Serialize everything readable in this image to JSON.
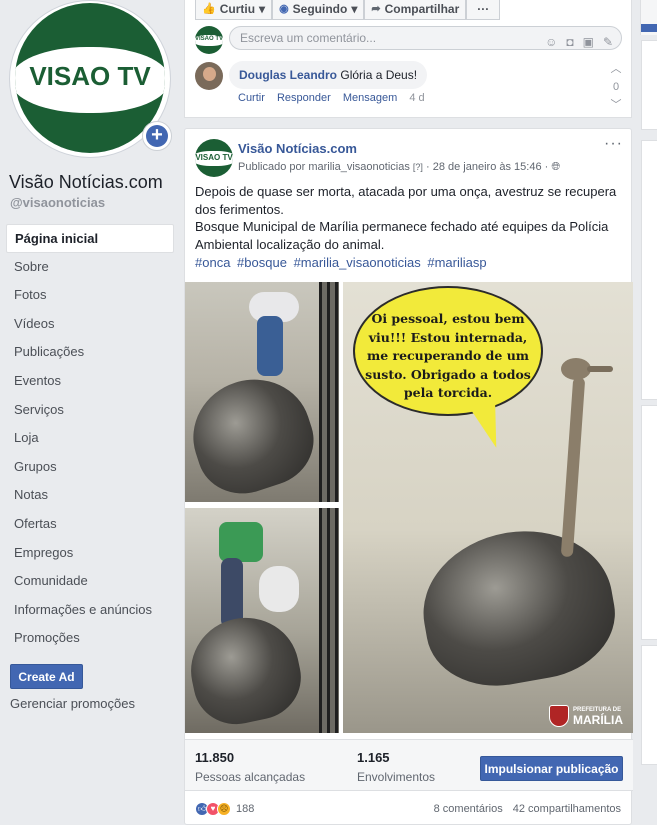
{
  "page": {
    "logo_text": "VISAO TV",
    "name": "Visão Notícias.com",
    "handle": "@visaonoticias"
  },
  "nav": [
    {
      "label": "Página inicial",
      "active": true
    },
    {
      "label": "Sobre"
    },
    {
      "label": "Fotos"
    },
    {
      "label": "Vídeos"
    },
    {
      "label": "Publicações"
    },
    {
      "label": "Eventos"
    },
    {
      "label": "Serviços"
    },
    {
      "label": "Loja"
    },
    {
      "label": "Grupos"
    },
    {
      "label": "Notas"
    },
    {
      "label": "Ofertas"
    },
    {
      "label": "Empregos"
    },
    {
      "label": "Comunidade"
    },
    {
      "label": "Informações e anúncios"
    },
    {
      "label": "Promoções"
    }
  ],
  "sidebar": {
    "create_ad": "Create Ad",
    "manage_promotions": "Gerenciar promoções"
  },
  "top_card": {
    "liked": "Curtiu",
    "following": "Seguindo",
    "share": "Compartilhar",
    "more": "···",
    "comment_placeholder": "Escreva um comentário...",
    "reply": {
      "author": "Douglas Leandro",
      "text": "Glória a Deus!",
      "like": "Curtir",
      "respond": "Responder",
      "message": "Mensagem",
      "time": "4 d",
      "votes": "0"
    }
  },
  "post": {
    "author": "Visão Notícias.com",
    "published_by_prefix": "Publicado por",
    "published_by": "marilia_visaonoticias",
    "published_marker": "[?]",
    "date": "28 de janeiro às 15:46",
    "more": "···",
    "text": [
      "Depois de quase ser morta, atacada por uma onça, avestruz se recupera dos ferimentos.",
      "Bosque Municipal de Marília permanece fechado até equipes da Polícia Ambiental localização do animal."
    ],
    "hashtags": [
      "#onca",
      "#bosque",
      "#marilia_visaonoticias",
      "#mariliasp"
    ],
    "speech_bubble": "Oi pessoal, estou bem viu!!! Estou internada, me recuperando de um susto. Obrigado a todos pela torcida.",
    "watermark_small": "PREFEITURA DE",
    "watermark_big": "MARÍLIA"
  },
  "stats": {
    "reach_value": "11.850",
    "reach_label": "Pessoas alcançadas",
    "engagement_value": "1.165",
    "engagement_label": "Envolvimentos",
    "boost_label": "Impulsionar publicação",
    "reaction_count": "188",
    "comments": "8 comentários",
    "shares": "42 compartilhamentos"
  },
  "colors": {
    "brand_blue": "#4267b2",
    "link_blue": "#385898",
    "logo_green": "#1b5e34",
    "speech_yellow": "#f2ea3a"
  }
}
